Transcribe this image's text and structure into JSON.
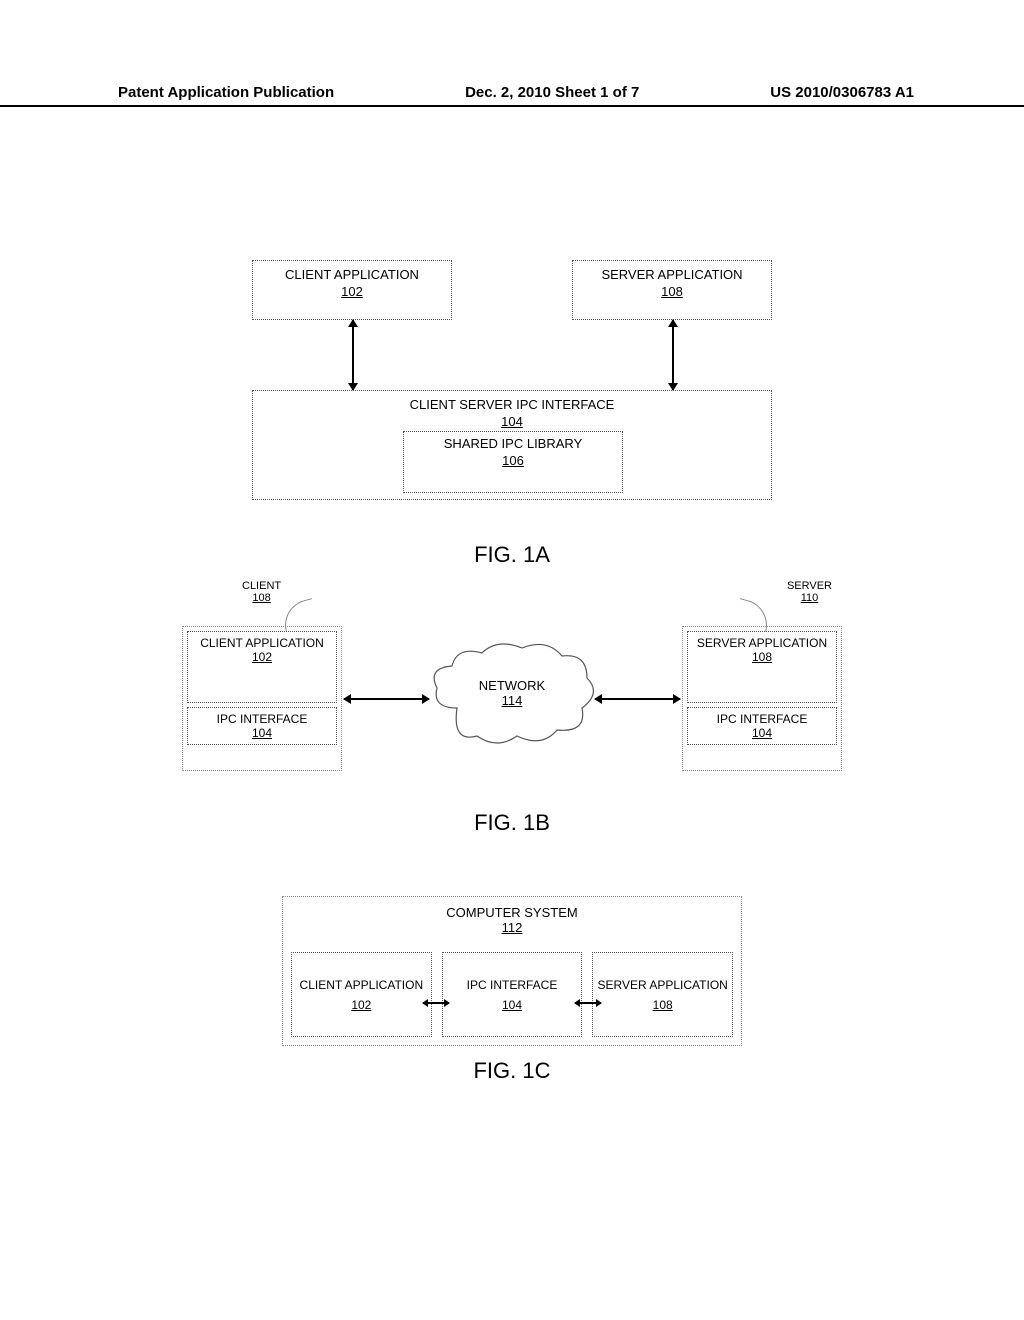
{
  "header": {
    "left": "Patent Application Publication",
    "center": "Dec. 2, 2010  Sheet 1 of 7",
    "right": "US 2010/0306783 A1"
  },
  "fig1a": {
    "label": "FIG. 1A",
    "client": {
      "title": "CLIENT APPLICATION",
      "num": "102"
    },
    "server": {
      "title": "SERVER APPLICATION",
      "num": "108"
    },
    "ipc": {
      "title": "CLIENT SERVER IPC INTERFACE",
      "num": "104"
    },
    "lib": {
      "title": "SHARED IPC LIBRARY",
      "num": "106"
    }
  },
  "fig1b": {
    "label": "FIG. 1B",
    "tag_client": {
      "title": "CLIENT",
      "num": "108"
    },
    "tag_server": {
      "title": "SERVER",
      "num": "110"
    },
    "client_app": {
      "title": "CLIENT APPLICATION",
      "num": "102"
    },
    "client_ipc": {
      "title": "IPC INTERFACE",
      "num": "104"
    },
    "server_app": {
      "title": "SERVER APPLICATION",
      "num": "108"
    },
    "server_ipc": {
      "title": "IPC INTERFACE",
      "num": "104"
    },
    "network": {
      "title": "NETWORK",
      "num": "114"
    }
  },
  "fig1c": {
    "label": "FIG. 1C",
    "system": {
      "title": "COMPUTER SYSTEM",
      "num": "112"
    },
    "client": {
      "title": "CLIENT APPLICATION",
      "num": "102"
    },
    "ipc": {
      "title": "IPC INTERFACE",
      "num": "104"
    },
    "server": {
      "title": "SERVER APPLICATION",
      "num": "108"
    }
  }
}
